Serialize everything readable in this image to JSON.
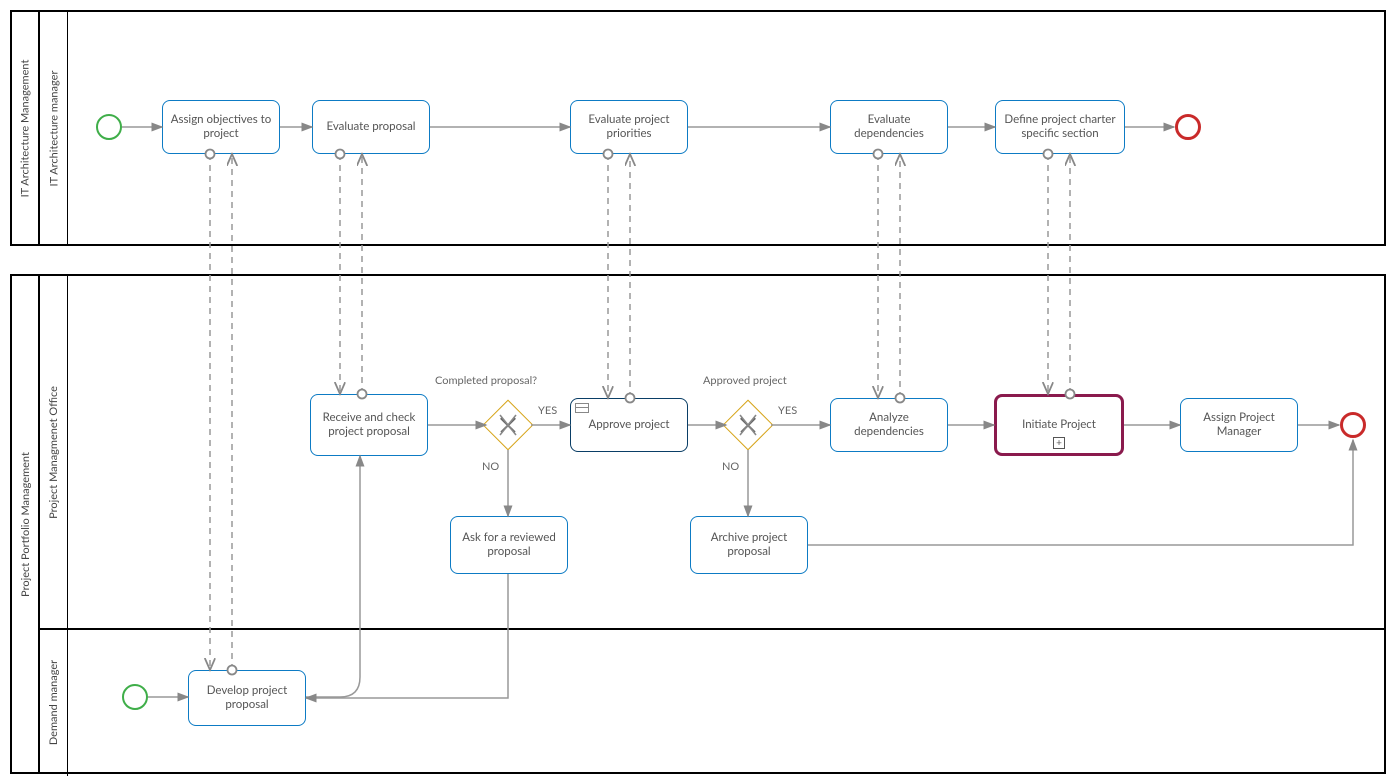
{
  "pools": {
    "top": {
      "title": "IT Architecture Management"
    },
    "bottom": {
      "title": "Project Portfolio Management"
    }
  },
  "lanes": {
    "top1": {
      "title": "IT Architecture manager"
    },
    "bot1": {
      "title": "Project Managmenet Office"
    },
    "bot2": {
      "title": "Demand manager"
    }
  },
  "tasks": {
    "assignObj": "Assign objectives to project",
    "evalProposal": "Evaluate proposal",
    "evalPriorities": "Evaluate project priorities",
    "evalDeps": "Evaluate dependencies",
    "defineCharter": "Define project charter specific section",
    "receiveCheck": "Receive and check project proposal",
    "approveProject": "Approve project",
    "analyzeDeps": "Analyze dependencies",
    "initiateProject": "Initiate Project",
    "assignPM": "Assign Project Manager",
    "askReviewed": "Ask for a reviewed proposal",
    "archive": "Archive project proposal",
    "developProposal": "Develop project proposal"
  },
  "labels": {
    "completedQ": "Completed proposal?",
    "approvedQ": "Approved project",
    "yes": "YES",
    "no": "NO"
  },
  "markers": {
    "plus": "+"
  }
}
